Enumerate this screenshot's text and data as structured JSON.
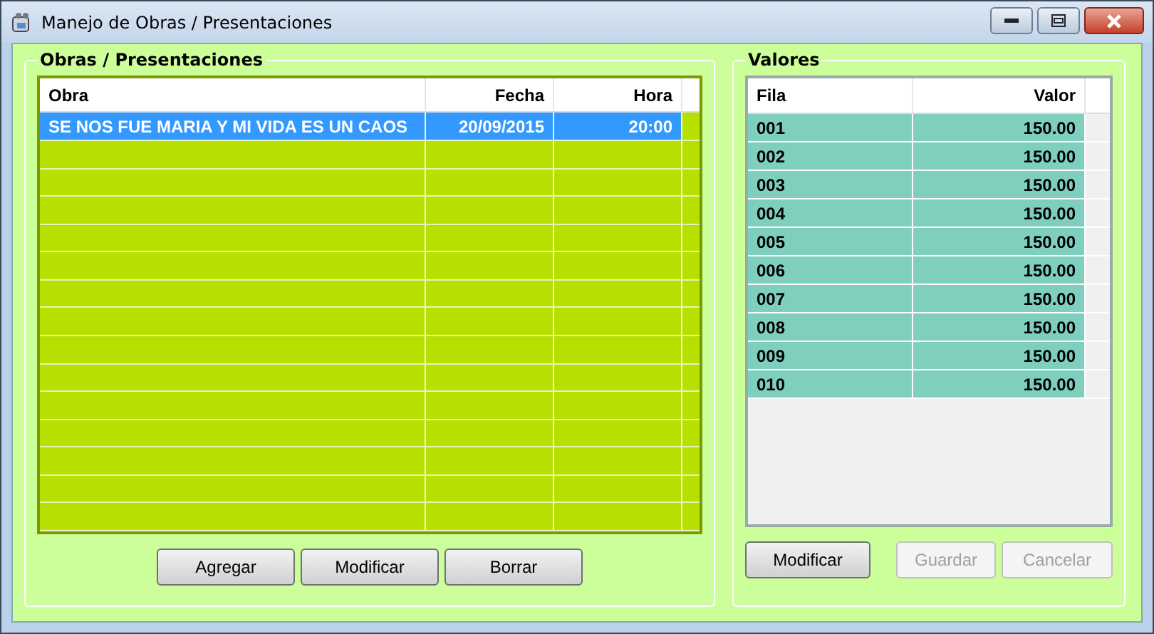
{
  "window": {
    "title": "Manejo de Obras / Presentaciones"
  },
  "obras": {
    "title": "Obras / Presentaciones",
    "columns": [
      "Obra",
      "Fecha",
      "Hora"
    ],
    "rows": [
      {
        "obra": "SE NOS FUE MARIA Y MI VIDA ES UN  CAOS",
        "fecha": "20/09/2015",
        "hora": "20:00",
        "selected": true
      }
    ],
    "buttons": [
      {
        "label": "Agregar",
        "disabled": false
      },
      {
        "label": "Modificar",
        "disabled": false
      },
      {
        "label": "Borrar",
        "disabled": false
      }
    ]
  },
  "valores": {
    "title": "Valores",
    "columns": [
      "Fila",
      "Valor"
    ],
    "rows": [
      {
        "fila": "001",
        "valor": "150.00"
      },
      {
        "fila": "002",
        "valor": "150.00"
      },
      {
        "fila": "003",
        "valor": "150.00"
      },
      {
        "fila": "004",
        "valor": "150.00"
      },
      {
        "fila": "005",
        "valor": "150.00"
      },
      {
        "fila": "006",
        "valor": "150.00"
      },
      {
        "fila": "007",
        "valor": "150.00"
      },
      {
        "fila": "008",
        "valor": "150.00"
      },
      {
        "fila": "009",
        "valor": "150.00"
      },
      {
        "fila": "010",
        "valor": "150.00"
      }
    ],
    "buttons": [
      {
        "label": "Modificar",
        "disabled": false
      },
      {
        "label": "Guardar",
        "disabled": true
      },
      {
        "label": "Cancelar",
        "disabled": true
      }
    ]
  }
}
